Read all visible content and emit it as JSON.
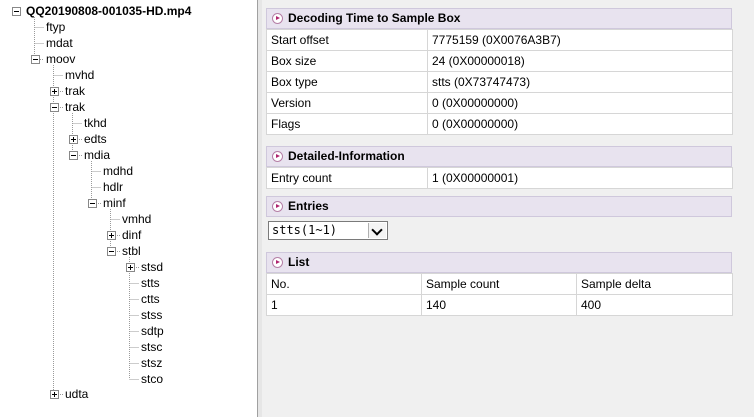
{
  "tree": {
    "root": "QQ20190808-001035-HD.mp4",
    "nodes": [
      "ftyp",
      "mdat",
      "moov",
      "mvhd",
      "trak",
      "trak",
      "tkhd",
      "edts",
      "mdia",
      "mdhd",
      "hdlr",
      "minf",
      "vmhd",
      "dinf",
      "stbl",
      "stsd",
      "stts",
      "ctts",
      "stss",
      "sdtp",
      "stsc",
      "stsz",
      "stco",
      "udta"
    ]
  },
  "box": {
    "title": "Decoding Time to Sample Box",
    "rows": [
      {
        "label": "Start offset",
        "value": "7775159 (0X0076A3B7)"
      },
      {
        "label": "Box size",
        "value": "24 (0X00000018)"
      },
      {
        "label": "Box type",
        "value": "stts (0X73747473)"
      },
      {
        "label": "Version",
        "value": "0 (0X00000000)"
      },
      {
        "label": "Flags",
        "value": "0 (0X00000000)"
      }
    ]
  },
  "detail": {
    "title": "Detailed-Information",
    "rows": [
      {
        "label": "Entry count",
        "value": "1 (0X00000001)"
      }
    ]
  },
  "entries": {
    "title": "Entries",
    "selected": "stts(1~1)"
  },
  "list": {
    "title": "List",
    "columns": [
      "No.",
      "Sample count",
      "Sample delta"
    ],
    "rows": [
      [
        "1",
        "140",
        "400"
      ]
    ]
  }
}
